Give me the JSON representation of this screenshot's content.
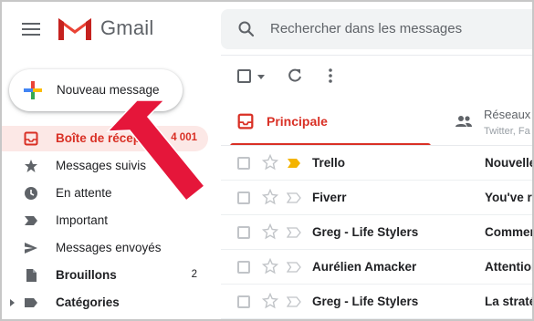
{
  "header": {
    "app_name": "Gmail",
    "search_placeholder": "Rechercher dans les messages"
  },
  "compose": {
    "label": "Nouveau message"
  },
  "sidebar": {
    "items": [
      {
        "label": "Boîte de réception",
        "count": "4 001",
        "icon": "inbox-icon",
        "active": true
      },
      {
        "label": "Messages suivis",
        "count": "",
        "icon": "star-icon"
      },
      {
        "label": "En attente",
        "count": "",
        "icon": "clock-icon"
      },
      {
        "label": "Important",
        "count": "",
        "icon": "important-icon"
      },
      {
        "label": "Messages envoyés",
        "count": "",
        "icon": "send-icon"
      },
      {
        "label": "Brouillons",
        "count": "2",
        "icon": "draft-icon",
        "bold": true
      },
      {
        "label": "Catégories",
        "count": "",
        "icon": "label-icon",
        "bold": true
      }
    ]
  },
  "tabs": {
    "principal": "Principale",
    "reseaux": "Réseaux",
    "reseaux_sub": "Twitter, Fa"
  },
  "emails": [
    {
      "sender": "Trello",
      "subject": "Nouvelle",
      "important": true
    },
    {
      "sender": "Fiverr",
      "subject": "You've re",
      "important": false
    },
    {
      "sender": "Greg - Life Stylers",
      "subject": "Commen",
      "important": false
    },
    {
      "sender": "Aurélien Amacker",
      "subject": "Attention",
      "important": false
    },
    {
      "sender": "Greg - Life Stylers",
      "subject": "La straté",
      "important": false
    }
  ],
  "colors": {
    "accent_red": "#d93025",
    "arrow_red": "#e5163a",
    "important_yellow": "#f4b400"
  }
}
